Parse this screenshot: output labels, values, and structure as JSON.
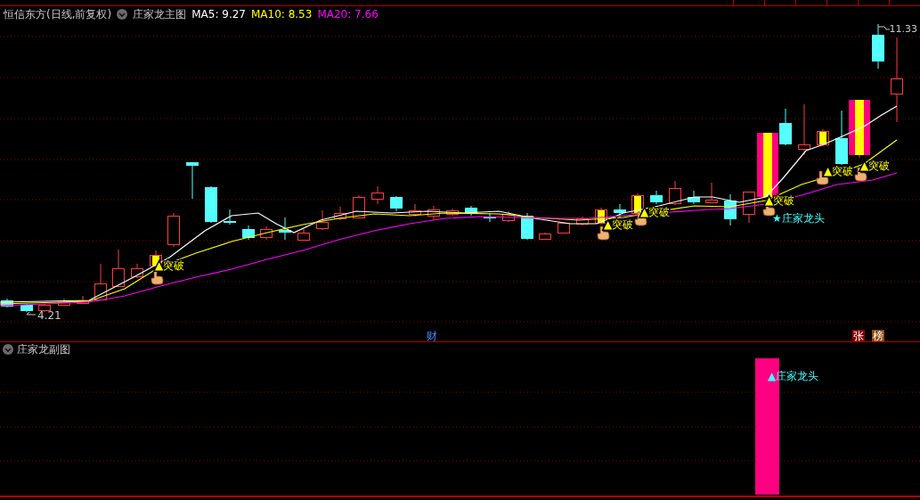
{
  "header": {
    "stock": "恒信东方(日线,前复权)",
    "indicator": "庄家龙主图",
    "ma": [
      {
        "label": "MA5: 9.27",
        "color": "#ffffff"
      },
      {
        "label": "MA10: 8.53",
        "color": "#ffff00"
      },
      {
        "label": "MA20: 7.66",
        "color": "#ff00ff"
      }
    ]
  },
  "main_chart": {
    "high_label": "11.33",
    "low_label": "4.21",
    "signals": [
      {
        "kind": "breakout",
        "text": "▲突破"
      },
      {
        "kind": "breakout",
        "text": "▲突破"
      },
      {
        "kind": "breakout",
        "text": "▲突破"
      },
      {
        "kind": "breakout",
        "text": "▲突破"
      },
      {
        "kind": "breakout",
        "text": "▲突破"
      },
      {
        "kind": "breakout",
        "text": "▲突破"
      },
      {
        "kind": "dragon",
        "text": "★庄家龙头"
      }
    ],
    "markers": [
      {
        "kind": "finance",
        "text": "财"
      },
      {
        "kind": "limit",
        "text": "张"
      },
      {
        "kind": "list",
        "text": "榜"
      }
    ]
  },
  "sub_panel": {
    "title": "庄家龙副图",
    "signal": "▲庄家龙头"
  }
}
